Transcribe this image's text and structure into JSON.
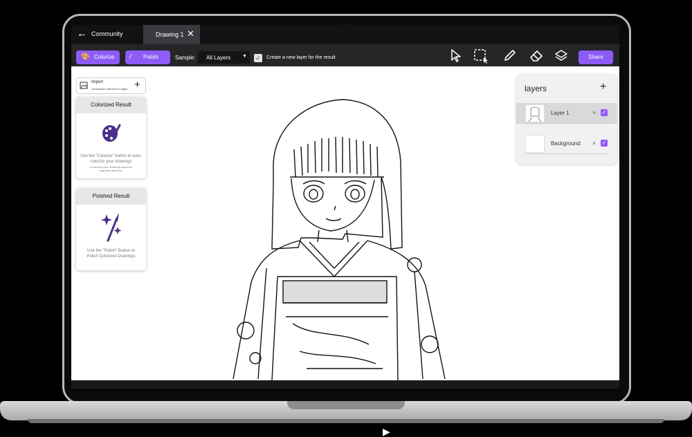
{
  "topbar": {
    "back_icon": "arrow-left-icon",
    "community_label": "Community",
    "tab_label": "Drawing 1",
    "tab_close_icon": "close-icon"
  },
  "toolbar": {
    "colorize_label": "Colorize",
    "polish_label": "Polish",
    "sample_label": "Sample:",
    "sample_value": "All Layers",
    "new_layer_checked": true,
    "new_layer_label": "Create a new layer for the result",
    "tools": [
      "pointer-icon",
      "selection-icon",
      "pencil-icon",
      "eraser-icon",
      "layers-icon"
    ],
    "share_label": "Share",
    "accent_color": "#8d5cf5"
  },
  "left_panel": {
    "import_title": "Import",
    "import_subtitle": "colorization reference images",
    "colorized_title": "Colorized Result",
    "colorized_text": "Use the \"Colorize\" button to auto-colorize your drawings",
    "colorized_subtext": "or colorize your drawings based on imported reference",
    "polished_title": "Poished Result",
    "polished_text": "Use the \"Polish\" Button to Polish Colorized Drawings"
  },
  "layers_panel": {
    "title": "layers",
    "layers": [
      {
        "name": "Layer 1",
        "mode": "N",
        "visible": true,
        "selected": true
      },
      {
        "name": "Background",
        "mode": "B",
        "visible": true,
        "selected": false
      }
    ]
  }
}
